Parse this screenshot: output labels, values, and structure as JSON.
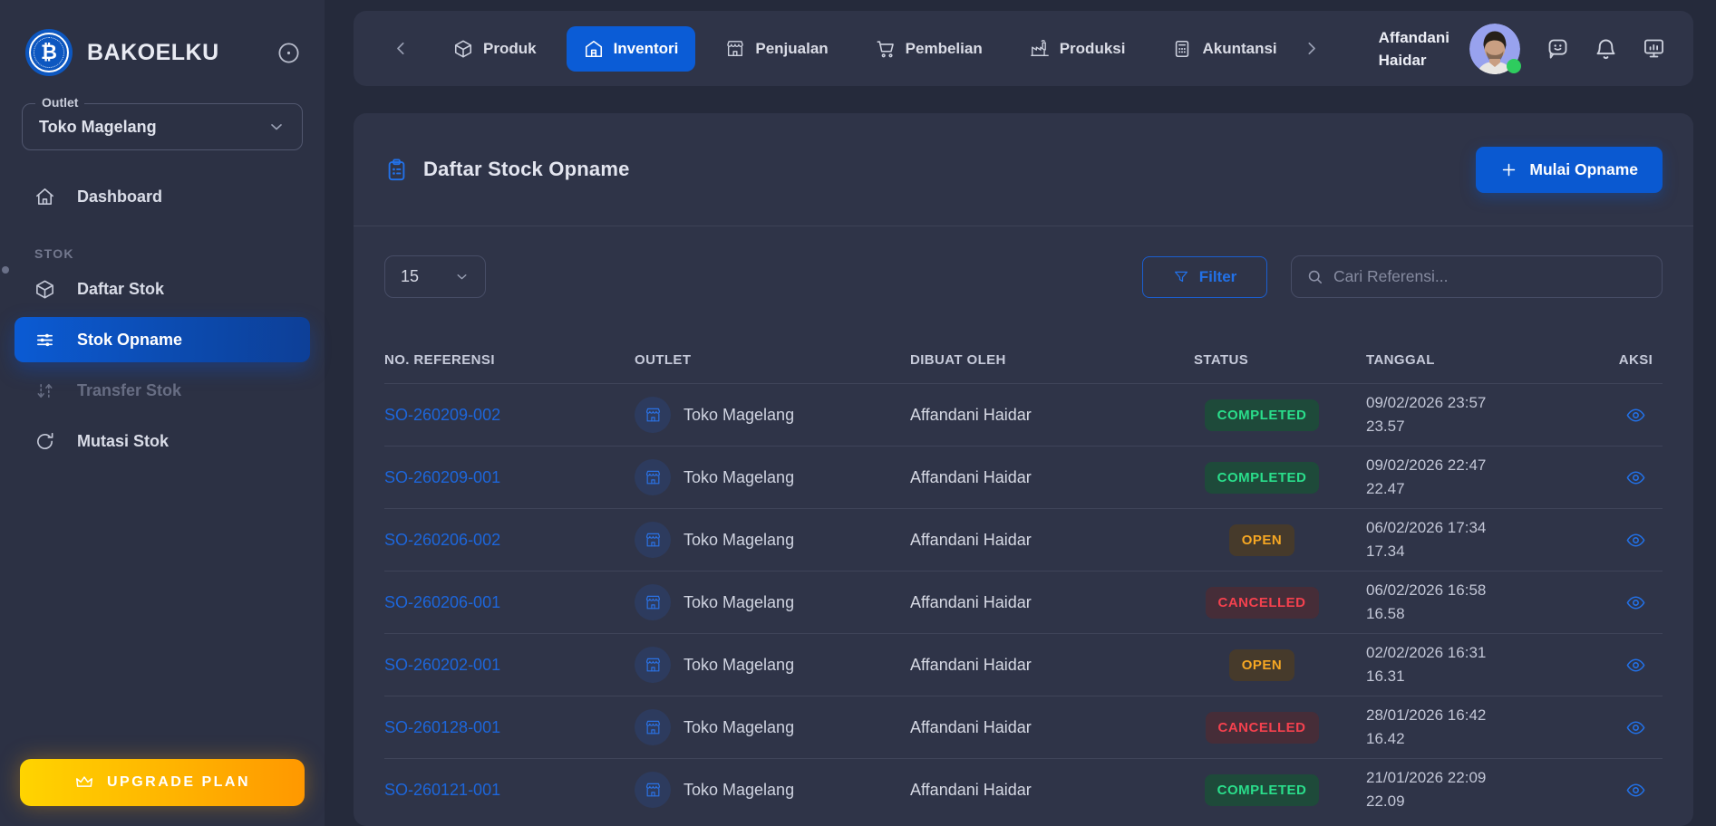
{
  "sidebar": {
    "brand": "BAKOELKU",
    "logo_symbol": "₿",
    "outlet_label": "Outlet",
    "outlet_value": "Toko Magelang",
    "menu_top": [
      {
        "label": "Dashboard",
        "icon": "home",
        "state": "normal"
      }
    ],
    "section_label": "STOK",
    "menu_stok": [
      {
        "label": "Daftar Stok",
        "icon": "cube",
        "state": "normal"
      },
      {
        "label": "Stok Opname",
        "icon": "sliders",
        "state": "active"
      },
      {
        "label": "Transfer Stok",
        "icon": "transfer",
        "state": "disabled"
      },
      {
        "label": "Mutasi Stok",
        "icon": "refresh",
        "state": "normal"
      }
    ],
    "upgrade_label": "UPGRADE PLAN"
  },
  "topbar": {
    "tabs": [
      {
        "label": "Produk",
        "icon": "cube",
        "active": false
      },
      {
        "label": "Inventori",
        "icon": "warehouse",
        "active": true
      },
      {
        "label": "Penjualan",
        "icon": "store",
        "active": false
      },
      {
        "label": "Pembelian",
        "icon": "cart",
        "active": false
      },
      {
        "label": "Produksi",
        "icon": "factory",
        "active": false
      },
      {
        "label": "Akuntansi",
        "icon": "calculator",
        "active": false
      }
    ],
    "user_name_line1": "Affandani",
    "user_name_line2": "Haidar"
  },
  "page": {
    "title": "Daftar Stock Opname",
    "primary_action": "Mulai Opname",
    "page_size": "15",
    "filter_label": "Filter",
    "search_placeholder": "Cari Referensi..."
  },
  "table": {
    "columns": [
      "NO. REFERENSI",
      "OUTLET",
      "DIBUAT OLEH",
      "STATUS",
      "TANGGAL",
      "AKSI"
    ],
    "rows": [
      {
        "ref": "SO-260209-002",
        "outlet": "Toko Magelang",
        "created_by": "Affandani Haidar",
        "status": "COMPLETED",
        "date": "09/02/2026 23:57",
        "time": "23.57"
      },
      {
        "ref": "SO-260209-001",
        "outlet": "Toko Magelang",
        "created_by": "Affandani Haidar",
        "status": "COMPLETED",
        "date": "09/02/2026 22:47",
        "time": "22.47"
      },
      {
        "ref": "SO-260206-002",
        "outlet": "Toko Magelang",
        "created_by": "Affandani Haidar",
        "status": "OPEN",
        "date": "06/02/2026 17:34",
        "time": "17.34"
      },
      {
        "ref": "SO-260206-001",
        "outlet": "Toko Magelang",
        "created_by": "Affandani Haidar",
        "status": "CANCELLED",
        "date": "06/02/2026 16:58",
        "time": "16.58"
      },
      {
        "ref": "SO-260202-001",
        "outlet": "Toko Magelang",
        "created_by": "Affandani Haidar",
        "status": "OPEN",
        "date": "02/02/2026 16:31",
        "time": "16.31"
      },
      {
        "ref": "SO-260128-001",
        "outlet": "Toko Magelang",
        "created_by": "Affandani Haidar",
        "status": "CANCELLED",
        "date": "28/01/2026 16:42",
        "time": "16.42"
      },
      {
        "ref": "SO-260121-001",
        "outlet": "Toko Magelang",
        "created_by": "Affandani Haidar",
        "status": "COMPLETED",
        "date": "21/01/2026 22:09",
        "time": "22.09"
      }
    ]
  },
  "colors": {
    "accent_blue": "#0b5cd6",
    "link_blue": "#1d66db",
    "status_completed": "#2ade8b",
    "status_open": "#f6a723",
    "status_cancelled": "#f4414e",
    "upgrade_gradient_start": "#ffd400",
    "upgrade_gradient_end": "#ff9800",
    "sidebar_bg": "#2c3144",
    "card_bg": "#2f3448",
    "page_bg": "#252a3b"
  }
}
